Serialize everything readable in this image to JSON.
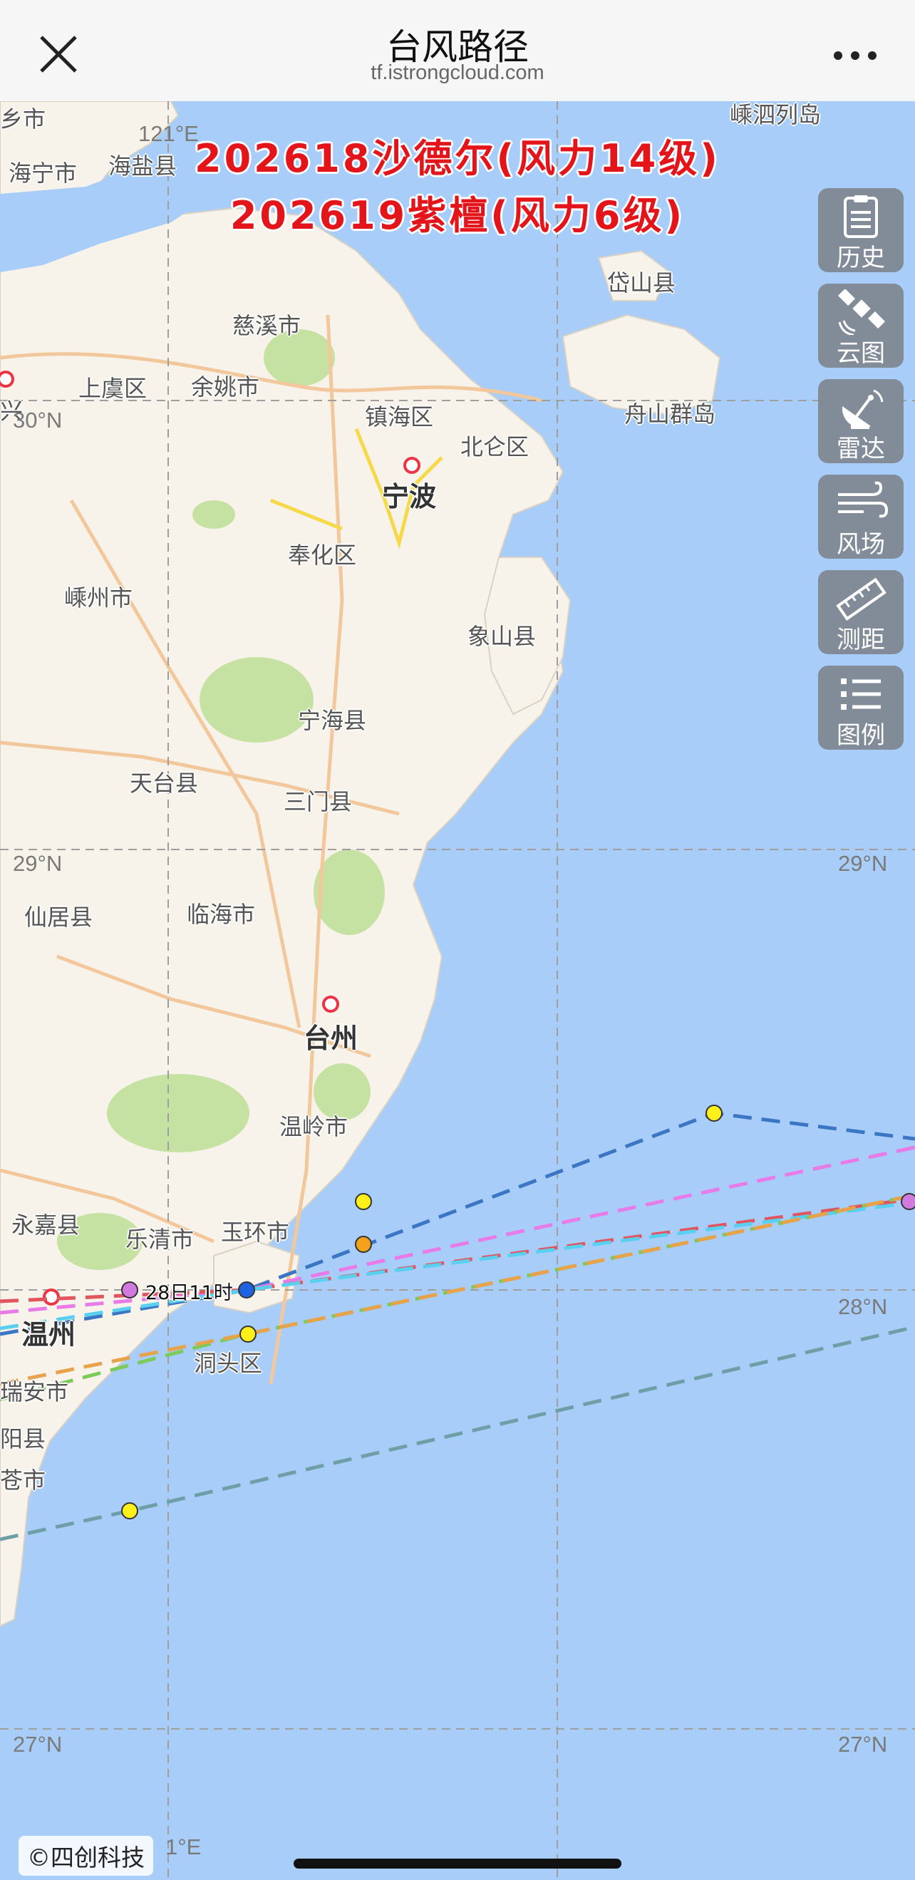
{
  "header": {
    "title": "台风路径",
    "url": "tf.istrongcloud.com"
  },
  "headline": {
    "line1": "202618沙德尔(风力14级)",
    "line2": "202619紫檀(风力6级)"
  },
  "tools": [
    {
      "label": "历史",
      "icon": "clipboard-icon"
    },
    {
      "label": "云图",
      "icon": "satellite-icon"
    },
    {
      "label": "雷达",
      "icon": "radar-dish-icon"
    },
    {
      "label": "风场",
      "icon": "wind-icon"
    },
    {
      "label": "测距",
      "icon": "ruler-icon"
    },
    {
      "label": "图例",
      "icon": "list-icon"
    }
  ],
  "places": {
    "ningbo": "宁波",
    "taizhou": "台州",
    "wenzhou": "温州",
    "cixi": "慈溪市",
    "yuyao": "余姚市",
    "shangyu": "上虞区",
    "zhenhai": "镇海区",
    "beilun": "北仑区",
    "fenghua": "奉化区",
    "shengzhou": "嵊州市",
    "xiangshan": "象山县",
    "ninghai": "宁海县",
    "tiantai": "天台县",
    "sanmen": "三门县",
    "xianju": "仙居县",
    "linhai": "临海市",
    "wenling": "温岭市",
    "yongjia": "永嘉县",
    "yueqing": "乐清市",
    "yuhuan": "玉环市",
    "dongtou": "洞头区",
    "ruian": "瑞安市",
    "haining": "海宁市",
    "haiyan": "海盐县",
    "daishan": "岱山县",
    "zhoushan": "舟山群岛",
    "shengsi": "嵊泗列岛",
    "pingyang": "阳县",
    "cangnan": "苍市",
    "shaoxing": "兴",
    "haining_partial": "乡市"
  },
  "grid_labels": {
    "lat29_left": "29°N",
    "lat29_right": "29°N",
    "lat28_right": "28°N",
    "lat27_left": "27°N",
    "lat27_right": "27°N",
    "lat30_left": "30°N",
    "lon121_top": "121°E",
    "lon121_bottom": "1°E"
  },
  "forecast_label": "28日11时",
  "copyright": "©四创科技",
  "colors": {
    "sea": "#a7cdf8",
    "land": "#f8f3ea",
    "red_title": "#e3151b",
    "track_blue": "#3a76c4",
    "track_pink": "#e87be8",
    "track_red": "#e2555e",
    "track_cyan": "#5ad0f0",
    "track_green": "#7ccb5a",
    "track_orange": "#e8a24a",
    "track_teal": "#6f9fa6",
    "point_yellow": "#ffef1a",
    "point_orange": "#f4a11c",
    "point_blue": "#1f63e0",
    "point_purple": "#d07ae0"
  }
}
